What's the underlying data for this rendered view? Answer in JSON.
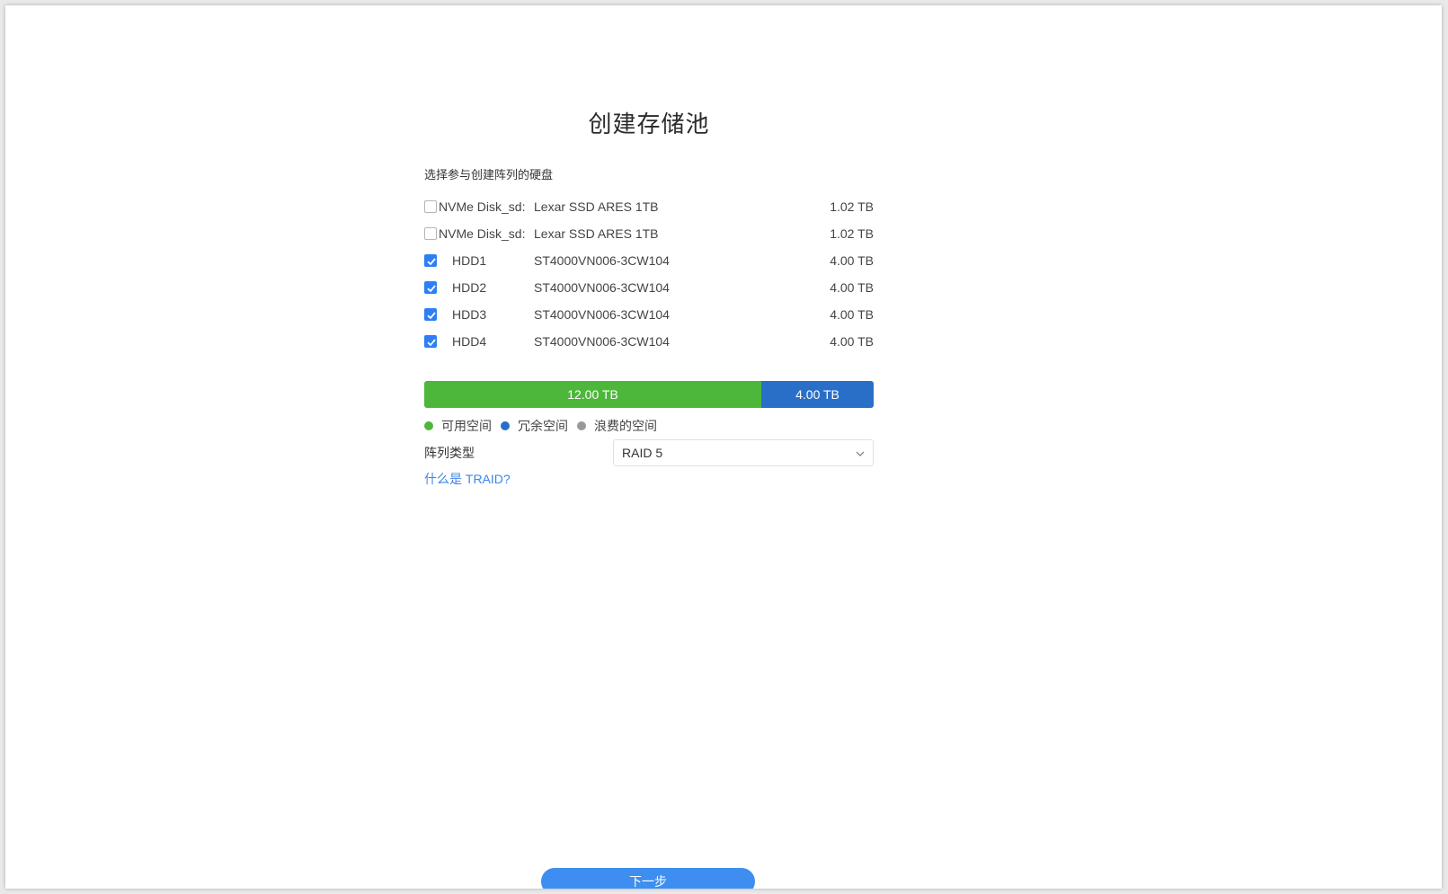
{
  "title": "创建存储池",
  "subtitle": "选择参与创建阵列的硬盘",
  "disks": [
    {
      "name": "NVMe Disk_sd:",
      "model": "Lexar SSD ARES 1TB",
      "size": "1.02 TB",
      "checked": false
    },
    {
      "name": "NVMe Disk_sd:",
      "model": "Lexar SSD ARES 1TB",
      "size": "1.02 TB",
      "checked": false
    },
    {
      "name": "HDD1",
      "model": "ST4000VN006-3CW104",
      "size": "4.00 TB",
      "checked": true
    },
    {
      "name": "HDD2",
      "model": "ST4000VN006-3CW104",
      "size": "4.00 TB",
      "checked": true
    },
    {
      "name": "HDD3",
      "model": "ST4000VN006-3CW104",
      "size": "4.00 TB",
      "checked": true
    },
    {
      "name": "HDD4",
      "model": "ST4000VN006-3CW104",
      "size": "4.00 TB",
      "checked": true
    }
  ],
  "capacity": {
    "available_label": "12.00 TB",
    "redundant_label": "4.00 TB",
    "available_fraction": 0.75,
    "redundant_fraction": 0.25
  },
  "legend": [
    {
      "label": "可用空间",
      "color": "#4db73b"
    },
    {
      "label": "冗余空间",
      "color": "#2a6fc7"
    },
    {
      "label": "浪费的空间",
      "color": "#999999"
    }
  ],
  "raid": {
    "label": "阵列类型",
    "selected": "RAID 5"
  },
  "traid_link": "什么是 TRAID?",
  "next_button": "下一步",
  "colors": {
    "accent": "#2d7ff5",
    "button": "#3d8ef0",
    "link": "#3d86e6"
  }
}
